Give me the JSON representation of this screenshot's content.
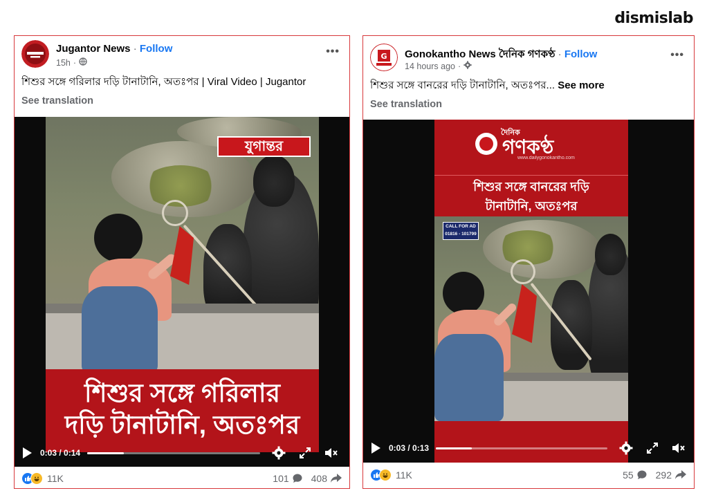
{
  "watermark": "dismislab",
  "posts": [
    {
      "page_name": "Jugantor News",
      "follow": "Follow",
      "time": "15h",
      "caption": "শিশুর সঙ্গে গরিলার দড়ি টানাটানি, অতঃপর | Viral Video | Jugantor",
      "see_more": "",
      "see_translation": "See translation",
      "video": {
        "logo_text": "যুগান্তর",
        "overlay_line1": "শিশুর সঙ্গে গরিলার",
        "overlay_line2": "দড়ি টানাটানি, অতঃপর",
        "time": "0:03 / 0:14",
        "progress": 0.21
      },
      "reactions": "11K",
      "comments": "101",
      "shares": "408"
    },
    {
      "page_name": "Gonokantho News দৈনিক গণকণ্ঠ",
      "follow": "Follow",
      "time": "14 hours ago",
      "caption": "শিশুর সঙ্গে বানরের দড়ি টানাটানি, অতঃপর...",
      "see_more": "See more",
      "see_translation": "See translation",
      "video": {
        "logo_text": "গণকণ্ঠ",
        "logo_sub": "দৈনিক",
        "logo_url": "www.dailygonokantho.com",
        "overlay_line1": "শিশুর সঙ্গে বানরের দড়ি",
        "overlay_line2": "টানাটানি, অতঃপর",
        "ad_label": "CALL FOR AD",
        "ad_phone": "01816 - 101799",
        "time": "0:03 / 0:13",
        "progress": 0.21
      },
      "reactions": "11K",
      "comments": "55",
      "shares": "292"
    }
  ],
  "colors": {
    "accent": "#1877f2",
    "card_border": "#d7373a",
    "overlay_red": "#b3141a"
  }
}
